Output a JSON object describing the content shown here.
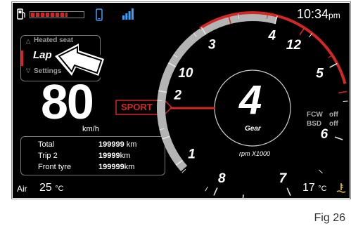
{
  "status_bar": {
    "time": "10:34",
    "time_suffix": "pm"
  },
  "menu": {
    "items": [
      "Heated seat",
      "Lap",
      "Settings"
    ],
    "selected_index": 1
  },
  "speed": {
    "value": "80",
    "unit": "km/h"
  },
  "mode": "SPORT",
  "gear": {
    "value": "4",
    "label": "Gear"
  },
  "rpm_label": "rpm X1000",
  "rpm_scale": [
    "1",
    "2",
    "3",
    "4",
    "5",
    "6",
    "7",
    "8",
    "10",
    "12"
  ],
  "indicators": [
    {
      "label": "FCW",
      "value": "off"
    },
    {
      "label": "BSD",
      "value": "off"
    }
  ],
  "trip": [
    {
      "label": "Total",
      "value": "199999",
      "unit": "km"
    },
    {
      "label": "Trip 2",
      "value": "19999",
      "unit": "km"
    },
    {
      "label": "Front tyre",
      "value": "199999",
      "unit": "km"
    }
  ],
  "air": {
    "label": "Air",
    "value": "25",
    "unit": "°C"
  },
  "coolant": {
    "value": "17",
    "unit": "°C"
  },
  "figure_label": "Fig 26",
  "colors": {
    "accent": "#d32626",
    "background": "#000000",
    "text": "#ffffff"
  },
  "fuel_level": 0.7,
  "signal_bars": 4
}
